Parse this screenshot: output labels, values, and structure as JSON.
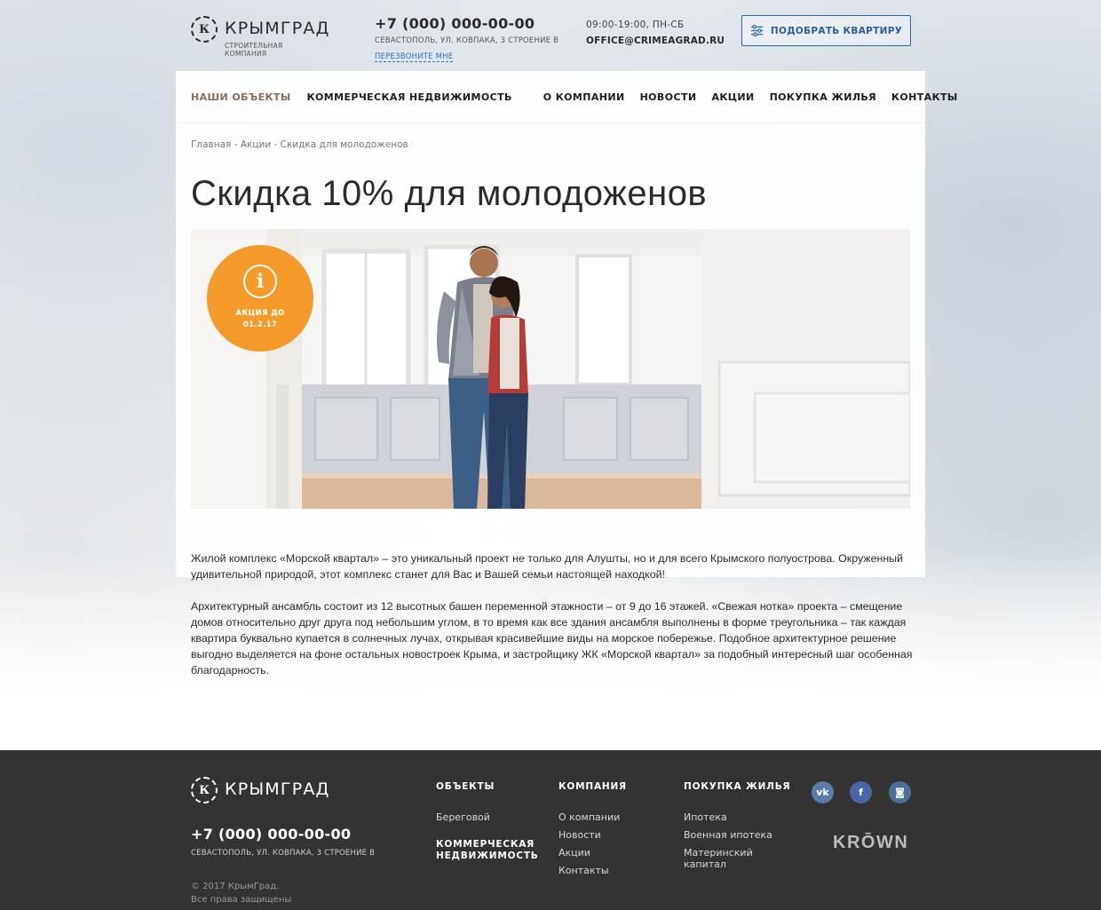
{
  "header": {
    "logo_name": "КРЫМГРАД",
    "logo_mark": "К",
    "logo_sub": "СТРОИТЕЛЬНАЯ КОМПАНИЯ",
    "phone": "+7 (000) 000-00-00",
    "address": "СЕВАСТОПОЛЬ, УЛ. КОВПАКА, 3 СТРОЕНИЕ В",
    "callback": "ПЕРЕЗВОНИТЕ МНЕ",
    "hours": "09:00-19:00, ПН-СБ",
    "email": "OFFICE@CRIMEAGRAD.RU",
    "pick_button": "ПОДОБРАТЬ КВАРТИРУ",
    "pick_icon": "sliders-icon"
  },
  "nav": {
    "items": [
      {
        "label": "НАШИ ОБЪЕКТЫ",
        "active": true
      },
      {
        "label": "КОММЕРЧЕСКАЯ НЕДВИЖИМОСТЬ",
        "active": false
      },
      {
        "label": "О КОМПАНИИ",
        "active": false
      },
      {
        "label": "НОВОСТИ",
        "active": false
      },
      {
        "label": "АКЦИИ",
        "active": false
      },
      {
        "label": "ПОКУПКА ЖИЛЬЯ",
        "active": false
      },
      {
        "label": "КОНТАКТЫ",
        "active": false
      }
    ]
  },
  "breadcrumb": {
    "items": [
      "Главная",
      "Акции",
      "Скидка для молодоженов"
    ],
    "separator": " - "
  },
  "page": {
    "title": "Скидка 10% для молодоженов",
    "badge_icon": "info-icon",
    "badge_glyph": "i",
    "badge_label": "АКЦИЯ ДО",
    "badge_date": "01.2.17",
    "paragraph1": "Жилой комплекс «Морской квартал» – это уникальный проект не только для Алушты, но и для всего Крымского полуострова. Окруженный удивительной природой, этот комплекс станет для Вас и Вашей семьи настоящей находкой!",
    "paragraph2": "Архитектурный ансамбль состоит из 12 высотных башен переменной этажности – от 9 до 16 этажей. «Свежая нотка» проекта – смещение домов относительно друг друга под небольшим углом, в то время как все здания ансамбля выполнены в форме треугольника – так каждая квартира буквально купается в солнечных лучах, открывая красивейшие виды на морское побережье. Подобное архитектурное решение выгодно выделяется на фоне остальных новостроек Крыма, и застройщику ЖК «Морской квартал» за подобный интересный шаг особенная благодарность."
  },
  "footer": {
    "logo_name": "КРЫМГРАД",
    "logo_mark": "К",
    "phone": "+7 (000) 000-00-00",
    "address": "СЕВАСТОПОЛЬ, УЛ. КОВПАКА, 3 СТРОЕНИЕ В",
    "copyright": "© 2017 КрымГрад.",
    "rights": "Все права защищены",
    "col1": {
      "title": "ОБЪЕКТЫ",
      "links": [
        "Береговой"
      ],
      "bold_link": "КОММЕРЧЕСКАЯ НЕДВИЖИМОСТЬ"
    },
    "col2": {
      "title": "КОМПАНИЯ",
      "links": [
        "О компании",
        "Новости",
        "Акции",
        "Контакты"
      ]
    },
    "col3": {
      "title": "ПОКУПКА ЖИЛЬЯ",
      "links": [
        "Ипотека",
        "Военная ипотека",
        "Материнский капитал"
      ]
    },
    "social": [
      {
        "name": "vk-icon",
        "glyph": "vk"
      },
      {
        "name": "facebook-icon",
        "glyph": "f"
      },
      {
        "name": "instagram-icon",
        "glyph": "◙"
      }
    ],
    "krown": "KRŌWN"
  },
  "colors": {
    "accent": "#f39a2a",
    "link": "#2d77b8",
    "nav_active": "#8a6e58",
    "footer_bg": "#333333"
  }
}
